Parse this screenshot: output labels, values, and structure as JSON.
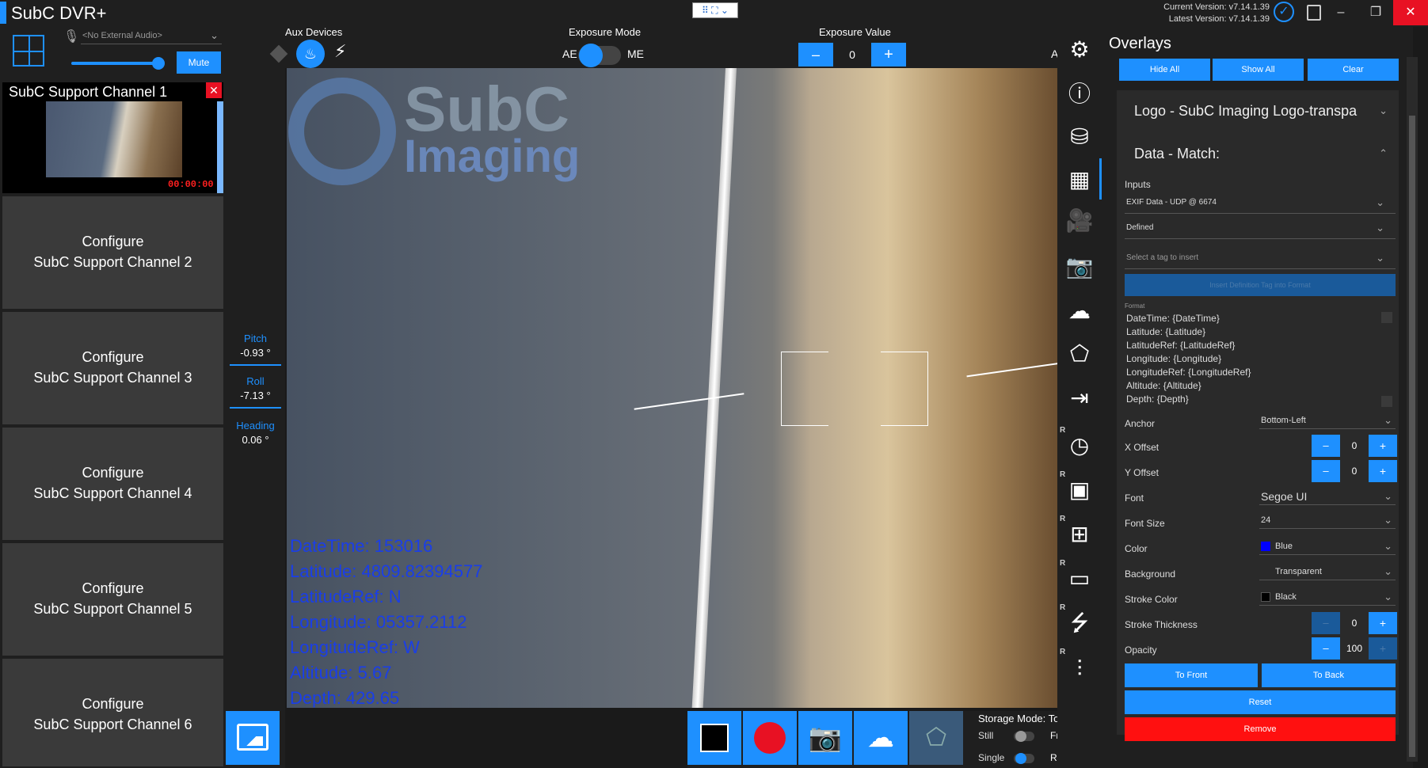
{
  "app": {
    "title": "SubC DVR+",
    "current_version": "Current Version: v7.14.1.39",
    "latest_version": "Latest Version: v7.14.1.39"
  },
  "window": {
    "minimize": "–",
    "restore": "❐",
    "close": "✕"
  },
  "audio": {
    "placeholder": "<No External Audio>",
    "mute_label": "Mute"
  },
  "channels": {
    "active": {
      "title": "SubC Support Channel 1",
      "time": "00:00:00"
    },
    "tiles": [
      {
        "line1": "Configure",
        "line2": "SubC Support Channel 2"
      },
      {
        "line1": "Configure",
        "line2": "SubC Support Channel 3"
      },
      {
        "line1": "Configure",
        "line2": "SubC Support Channel 4"
      },
      {
        "line1": "Configure",
        "line2": "SubC Support Channel 5"
      },
      {
        "line1": "Configure",
        "line2": "SubC Support Channel 6"
      }
    ]
  },
  "telemetry": {
    "pitch_label": "Pitch",
    "pitch": "-0.93 °",
    "roll_label": "Roll",
    "roll": "-7.13 °",
    "heading_label": "Heading",
    "heading": "0.06 °"
  },
  "controls": {
    "aux_label": "Aux Devices",
    "exposure_mode_label": "Exposure Mode",
    "ae": "AE",
    "me": "ME",
    "exposure_value_label": "Exposure Value",
    "exposure_value": "0",
    "minus": "–",
    "plus": "+",
    "truncated_a": "A"
  },
  "video": {
    "logo_top": "SubC",
    "logo_bottom": "Imaging",
    "overlay_lines": [
      "DateTime: 153016",
      "Latitude: 4809.82394577",
      "LatitudeRef: N",
      "Longitude: 05357.2112",
      "LongitudeRef: W",
      "Altitude: 5.67",
      "Depth: 429.65"
    ]
  },
  "storage": {
    "mode_label": "Storage Mode: Top",
    "still": "Still",
    "single": "Single",
    "fr": "Fr",
    "r": "R"
  },
  "overlays": {
    "title": "Overlays",
    "hide_all": "Hide All",
    "show_all": "Show All",
    "clear": "Clear",
    "logo_item": "Logo - SubC Imaging Logo-transpa",
    "data_item": "Data - Match:",
    "inputs_label": "Inputs",
    "input_source": "EXIF Data - UDP @ 6674",
    "defined": "Defined",
    "tag_placeholder": "Select a tag to insert",
    "insert_button": "Insert Definition Tag into Format",
    "format_label": "Format",
    "format_lines": [
      "DateTime: {DateTime}",
      "Latitude: {Latitude}",
      "LatitudeRef: {LatitudeRef}",
      "Longitude: {Longitude}",
      "LongitudeRef: {LongitudeRef}",
      "Altitude: {Altitude}",
      "Depth: {Depth}"
    ],
    "anchor_label": "Anchor",
    "anchor": "Bottom-Left",
    "x_offset_label": "X Offset",
    "x_offset": "0",
    "y_offset_label": "Y Offset",
    "y_offset": "0",
    "font_label": "Font",
    "font": "Segoe UI",
    "font_size_label": "Font Size",
    "font_size": "24",
    "color_label": "Color",
    "color": "Blue",
    "color_hex": "#0000ff",
    "background_label": "Background",
    "background": "Transparent",
    "stroke_color_label": "Stroke Color",
    "stroke_color": "Black",
    "stroke_hex": "#000000",
    "stroke_thickness_label": "Stroke Thickness",
    "stroke_thickness": "0",
    "opacity_label": "Opacity",
    "opacity": "100",
    "to_front": "To Front",
    "to_back": "To Back",
    "reset": "Reset",
    "remove": "Remove"
  },
  "side_icons": [
    "gear-icon",
    "info-icon",
    "database-icon",
    "layout-icon",
    "camera-settings-icon",
    "camera-icon",
    "cloud-icon",
    "network-icon",
    "export-icon",
    "clock-icon",
    "white-balance-icon",
    "hierarchy-icon",
    "cast-icon",
    "usb-icon",
    "sliders-icon"
  ],
  "colors": {
    "accent": "#1e90ff",
    "danger": "#ff1010",
    "overlay_text": "#1a3ee8"
  }
}
